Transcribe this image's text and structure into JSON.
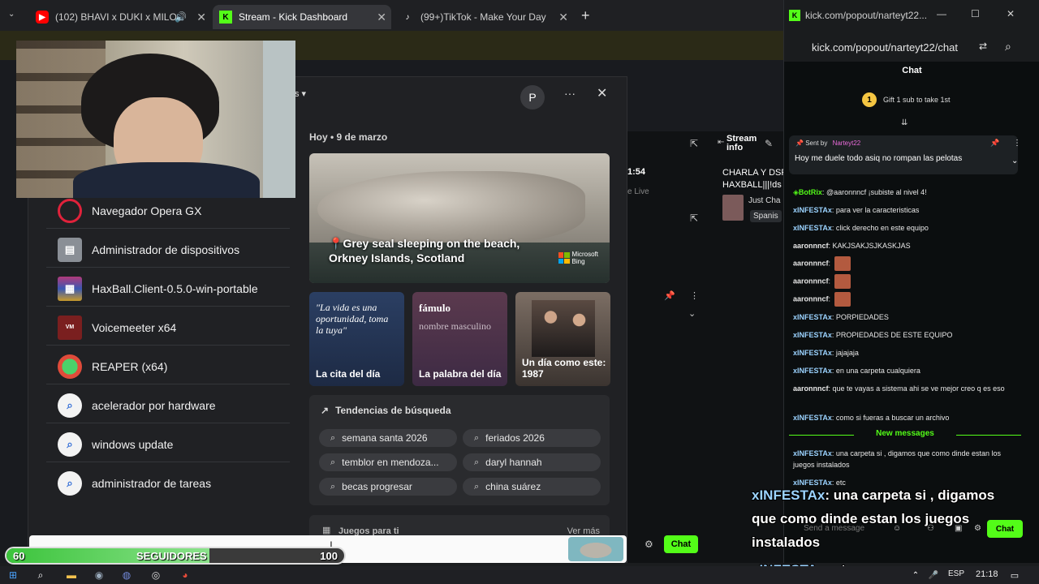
{
  "browser": {
    "tabs": [
      {
        "title": "(102) BHAVI x DUKI x MILO",
        "icon": "youtube-icon"
      },
      {
        "title": "Stream - Kick Dashboard",
        "icon": "kick-icon"
      },
      {
        "title": "(99+)TikTok - Make Your Day",
        "icon": "tiktok-icon"
      }
    ],
    "new_tab": "+"
  },
  "start_menu": {
    "apps": [
      {
        "label": "Navegador Opera GX",
        "icon": "opera-gx-icon"
      },
      {
        "label": "Administrador de dispositivos",
        "icon": "device-manager-icon"
      },
      {
        "label": "HaxBall.Client-0.5.0-win-portable",
        "icon": "winrar-icon"
      },
      {
        "label": "Voicemeeter x64",
        "icon": "voicemeeter-icon"
      },
      {
        "label": "REAPER (x64)",
        "icon": "reaper-icon"
      },
      {
        "label": "acelerador por hardware",
        "icon": "search-icon"
      },
      {
        "label": "windows update",
        "icon": "search-icon"
      },
      {
        "label": "administrador de tareas",
        "icon": "search-icon"
      }
    ],
    "profile_initial": "P",
    "more": "···",
    "close": "✕",
    "date_label": "Hoy  •  9 de marzo",
    "hero": {
      "caption_line1": "Grey seal sleeping on the beach,",
      "caption_line2": "Orkney Islands, Scotland",
      "logo_line1": "Microsoft",
      "logo_line2": "Bing"
    },
    "cards": [
      {
        "quote": "\"La vida es una oportunidad, toma la tuya\"",
        "title": "La cita del día"
      },
      {
        "word": "fámulo",
        "sub": "nombre masculino",
        "title": "La palabra del día"
      },
      {
        "title": "Un día como este:",
        "year": "1987"
      }
    ],
    "trends": {
      "title": "Tendencias de búsqueda",
      "items": [
        "semana santa 2026",
        "feriados 2026",
        "temblor en mendoza...",
        "daryl hannah",
        "becas progresar",
        "china suárez"
      ]
    },
    "games": {
      "title": "Juegos para ti",
      "more": "Ver más"
    }
  },
  "dashboard": {
    "stream_info": "Stream info",
    "clock": "1:54",
    "live": "e Live",
    "charla": "CHARLA Y DSP",
    "haxball": "HAXBALL|||!ds",
    "just_chatting": "Just Cha",
    "spanish": "Spanis",
    "chat_button": "Chat"
  },
  "chat": {
    "window_title": "kick.com/popout/narteyt22...",
    "url": "kick.com/popout/narteyt22/chat",
    "header": "Chat",
    "gift": "Gift 1 sub to take 1st",
    "pinned_sent_by": "Sent by",
    "pinned_user": "Narteyt22",
    "pinned_text": "Hoy me duele todo asiq no rompan las pelotas",
    "messages": [
      {
        "user": "BotRix",
        "text": "@aaronnncf ¡subiste al nivel 4!",
        "color": "#53fc18"
      },
      {
        "user": "xINFESTAx",
        "text": "para ver la caracteristicas",
        "color": "#9bd3ff"
      },
      {
        "user": "xINFESTAx",
        "text": "click derecho en este equipo",
        "color": "#9bd3ff"
      },
      {
        "user": "aaronnncf",
        "text": "KAKJSAKJSJKASKJAS",
        "color": "#ffffff"
      },
      {
        "user": "aaronnncf",
        "text": "",
        "emote": true,
        "color": "#ffffff"
      },
      {
        "user": "aaronnncf",
        "text": "",
        "emote": true,
        "color": "#ffffff"
      },
      {
        "user": "aaronnncf",
        "text": "",
        "emote": true,
        "color": "#ffffff"
      },
      {
        "user": "xINFESTAx",
        "text": "PORPIEDADES",
        "color": "#9bd3ff"
      },
      {
        "user": "xINFESTAx",
        "text": "PROPIEDADES DE ESTE EQUIPO",
        "color": "#9bd3ff"
      },
      {
        "user": "xINFESTAx",
        "text": "jajajaja",
        "color": "#9bd3ff"
      },
      {
        "user": "xINFESTAx",
        "text": "en una carpeta cualquiera",
        "color": "#9bd3ff"
      },
      {
        "user": "aaronnncf",
        "text": "que te vayas a sistema ahi se ve mejor creo q es eso",
        "color": "#ffffff"
      },
      {
        "user": "xINFESTAx",
        "text": "como si fueras a buscar un archivo",
        "color": "#9bd3ff"
      }
    ],
    "new_messages": "New messages",
    "after_new": [
      {
        "user": "xINFESTAx",
        "text": "una carpeta si , digamos que como dinde estan los juegos instalados",
        "color": "#9bd3ff"
      },
      {
        "user": "xINFESTAx",
        "text": "etc",
        "color": "#9bd3ff"
      }
    ],
    "send_placeholder": "Send a message",
    "send_button": "Chat"
  },
  "overlay": {
    "msg1_user": "xINFESTAx",
    "msg1_text": ": una carpeta si , digamos",
    "msg1_line2": "que como dinde estan los juegos",
    "msg1_line3": "instalados",
    "msg2_user": "xINFESTAx",
    "msg2_text": ": etc",
    "followers_current": "60",
    "followers_label": "SEGUIDORES",
    "followers_goal": "100",
    "followers_progress": 0.6
  },
  "taskbar": {
    "lang": "ESP",
    "time": "21:18"
  }
}
